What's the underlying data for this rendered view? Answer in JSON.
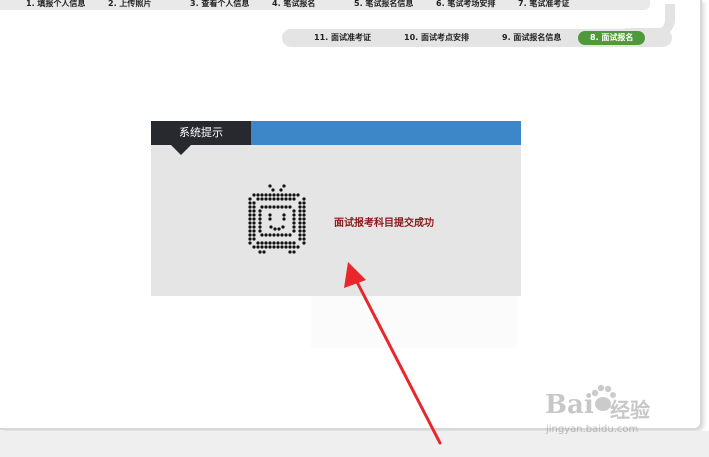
{
  "steps_top": [
    "1. 填报个人信息",
    "2. 上传照片",
    "3. 查看个人信息",
    "4. 笔试报名",
    "5. 笔试报名信息",
    "6. 笔试考场安排",
    "7. 笔试准考证"
  ],
  "steps_second": [
    "11. 面试准考证",
    "10. 面试考点安排",
    "9. 面试报名信息",
    "8. 面试报名"
  ],
  "active_step": "8. 面试报名",
  "notice": {
    "title": "系统提示",
    "message": "面试报考科目提交成功"
  },
  "watermark": {
    "brand": "Bai",
    "brand_suffix": "经验",
    "url": "jingyan.baidu.com"
  },
  "colors": {
    "header_blue": "#3d86c8",
    "title_dark": "#27292f",
    "active_tab_green": "#4e9a3a",
    "message_red": "#8b1a1a",
    "arrow_red": "#e8262b"
  },
  "icons": {
    "robot": "tv-robot-icon",
    "arrow": "annotation-arrow"
  }
}
